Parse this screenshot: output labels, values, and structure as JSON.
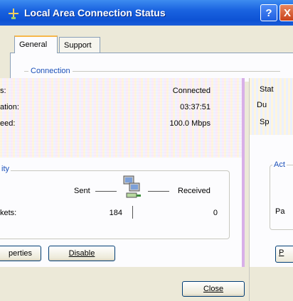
{
  "window": {
    "title": "Local Area Connection Status",
    "help_label": "?",
    "close_label": "X"
  },
  "tabs": [
    {
      "label": "General"
    },
    {
      "label": "Support"
    }
  ],
  "connection": {
    "legend": "Connection",
    "rows": [
      {
        "label": "s:",
        "value": "Connected"
      },
      {
        "label": "ation:",
        "value": "03:37:51"
      },
      {
        "label": "eed:",
        "value": "100.0 Mbps"
      }
    ]
  },
  "activity": {
    "legend": "ity",
    "sent_label": "Sent",
    "received_label": "Received",
    "packets_label": "kets:",
    "packets_sent": "184",
    "packets_received": "0"
  },
  "buttons": {
    "properties_label": "perties",
    "disable_label": "Disable",
    "close_label": "Close"
  },
  "right_pane": {
    "status_label": "Stat",
    "duration_label": "Du",
    "speed_label": "Sp",
    "activity_label": "Act",
    "packets_label": "Pa",
    "button_label": "P"
  }
}
